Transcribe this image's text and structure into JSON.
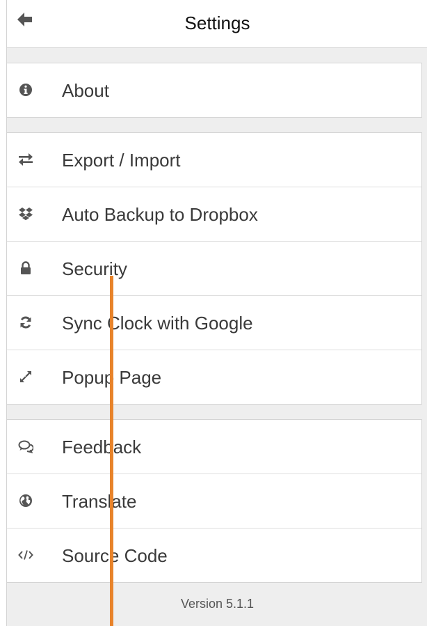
{
  "header": {
    "title": "Settings",
    "back_icon": "arrow-left-icon"
  },
  "groups": [
    {
      "items": [
        {
          "label": "About",
          "icon": "info-circle-icon"
        }
      ]
    },
    {
      "items": [
        {
          "label": "Export / Import",
          "icon": "exchange-icon"
        },
        {
          "label": "Auto Backup to Dropbox",
          "icon": "dropbox-icon"
        },
        {
          "label": "Security",
          "icon": "lock-icon"
        },
        {
          "label": "Sync Clock with Google",
          "icon": "refresh-icon"
        },
        {
          "label": "Popup Page",
          "icon": "expand-icon"
        }
      ]
    },
    {
      "items": [
        {
          "label": "Feedback",
          "icon": "comments-icon"
        },
        {
          "label": "Translate",
          "icon": "globe-icon"
        },
        {
          "label": "Source Code",
          "icon": "code-icon"
        }
      ]
    }
  ],
  "footer": {
    "version": "Version 5.1.1"
  },
  "colors": {
    "accent_line": "#e8832a",
    "icon": "#555555",
    "text": "#3a3a3a",
    "background": "#eeeeee"
  }
}
